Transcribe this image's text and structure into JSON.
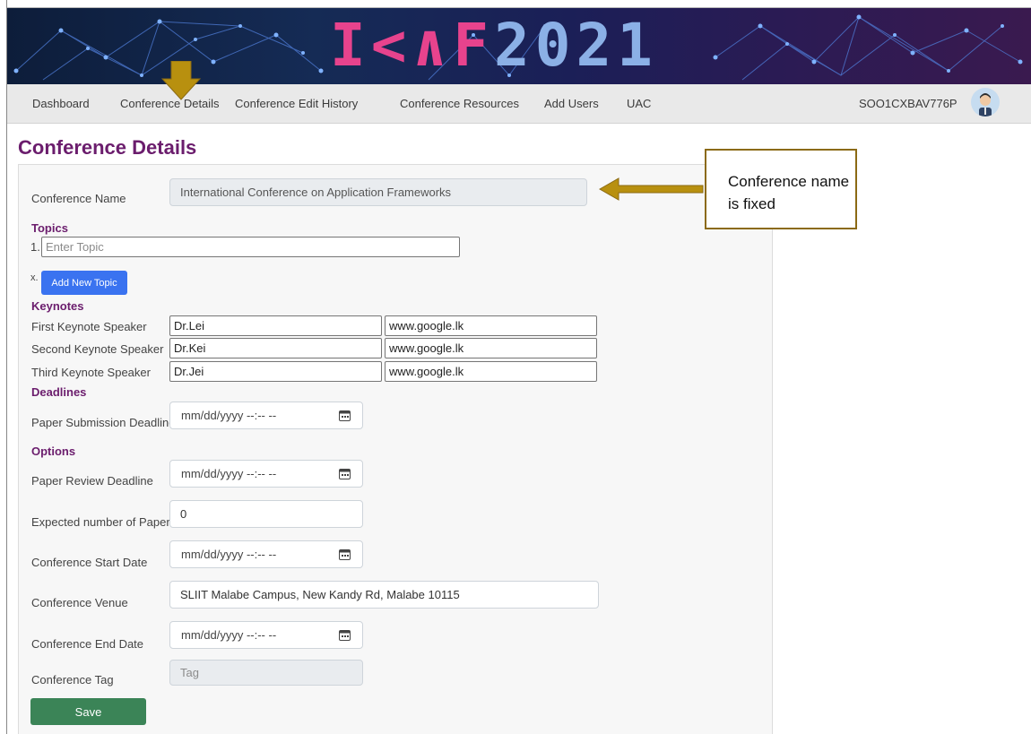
{
  "banner": {
    "title_a": "I<",
    "title_b": "∧F",
    "title_c": "2021"
  },
  "nav": {
    "items": [
      "Dashboard",
      "Conference Details",
      "Conference Edit History",
      "Conference Resources",
      "Add Users",
      "UAC"
    ],
    "user_id": "SOO1CXBAV776P"
  },
  "page": {
    "title": "Conference Details"
  },
  "form": {
    "conference_name_label": "Conference Name",
    "conference_name_value": "International Conference on Application Frameworks",
    "topics_heading": "Topics",
    "topic_number": "1.",
    "topic_placeholder": "Enter Topic",
    "topic_marker": "x.",
    "add_topic_label": "Add New Topic",
    "keynotes_heading": "Keynotes",
    "keynotes": [
      {
        "label": "First Keynote Speaker",
        "name": "Dr.Lei",
        "url": "www.google.lk"
      },
      {
        "label": "Second Keynote Speaker",
        "name": "Dr.Kei",
        "url": "www.google.lk"
      },
      {
        "label": "Third Keynote Speaker",
        "name": "Dr.Jei",
        "url": "www.google.lk"
      }
    ],
    "deadlines_heading": "Deadlines",
    "paper_submission_label": "Paper Submission Deadline",
    "date_placeholder": "mm/dd/yyyy --:-- --",
    "options_heading": "Options",
    "paper_review_label": "Paper Review Deadline",
    "expected_papers_label": "Expected number of Papers",
    "expected_papers_value": "0",
    "start_date_label": "Conference Start Date",
    "venue_label": "Conference Venue",
    "venue_value": "SLIIT Malabe Campus, New Kandy Rd, Malabe 10115",
    "end_date_label": "Conference End Date",
    "tag_label": "Conference Tag",
    "tag_placeholder": "Tag",
    "save_label": "Save"
  },
  "annotation": {
    "callout_text": "Conference name is fixed",
    "arrow_color": "#b8900f"
  },
  "colors": {
    "heading": "#6b1d6d",
    "button_blue": "#3a73f0",
    "button_green": "#3b8457"
  }
}
